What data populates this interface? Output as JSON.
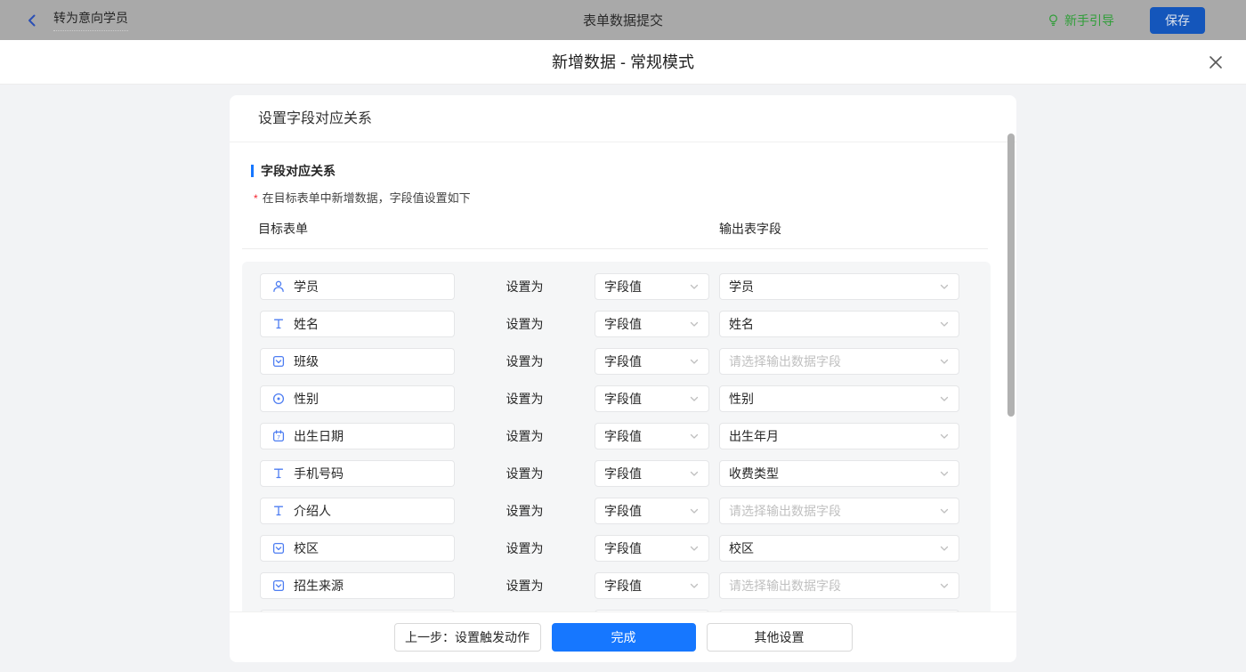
{
  "topbar": {
    "back_label": "转为意向学员",
    "title": "表单数据提交",
    "guide_label": "新手引导",
    "save_label": "保存"
  },
  "modal": {
    "title": "新增数据 - 常规模式"
  },
  "panel": {
    "header": "设置字段对应关系",
    "section_title": "字段对应关系",
    "required_mark": "*",
    "section_desc": "在目标表单中新增数据，字段值设置如下",
    "col_left": "目标表单",
    "col_right": "输出表字段",
    "set_as_label": "设置为",
    "output_placeholder_text": "请选择输出数据字段",
    "rows": [
      {
        "field": "学员",
        "icon": "user-icon",
        "value": "字段值",
        "output": "学员",
        "output_is_placeholder": false
      },
      {
        "field": "姓名",
        "icon": "text-icon",
        "value": "字段值",
        "output": "姓名",
        "output_is_placeholder": false
      },
      {
        "field": "班级",
        "icon": "select-icon",
        "value": "字段值",
        "output": "请选择输出数据字段",
        "output_is_placeholder": true
      },
      {
        "field": "性别",
        "icon": "radio-icon",
        "value": "字段值",
        "output": "性别",
        "output_is_placeholder": false
      },
      {
        "field": "出生日期",
        "icon": "date-icon",
        "value": "字段值",
        "output": "出生年月",
        "output_is_placeholder": false
      },
      {
        "field": "手机号码",
        "icon": "text-icon",
        "value": "字段值",
        "output": "收费类型",
        "output_is_placeholder": false
      },
      {
        "field": "介绍人",
        "icon": "text-icon",
        "value": "字段值",
        "output": "请选择输出数据字段",
        "output_is_placeholder": true
      },
      {
        "field": "校区",
        "icon": "select-icon",
        "value": "字段值",
        "output": "校区",
        "output_is_placeholder": false
      },
      {
        "field": "招生来源",
        "icon": "select-icon",
        "value": "字段值",
        "output": "请选择输出数据字段",
        "output_is_placeholder": true
      },
      {
        "field": "",
        "icon": "none",
        "value": "",
        "output": "",
        "output_is_placeholder": true
      }
    ],
    "footer": {
      "prev_label": "上一步：设置触发动作",
      "done_label": "完成",
      "other_label": "其他设置"
    }
  },
  "colors": {
    "accent_blue": "#1677ff",
    "field_icon_blue": "#4d7df2",
    "guide_green": "#2f9e38",
    "required_red": "#f5222d",
    "topbar_dimmed_bg": "#a9a9a9"
  }
}
